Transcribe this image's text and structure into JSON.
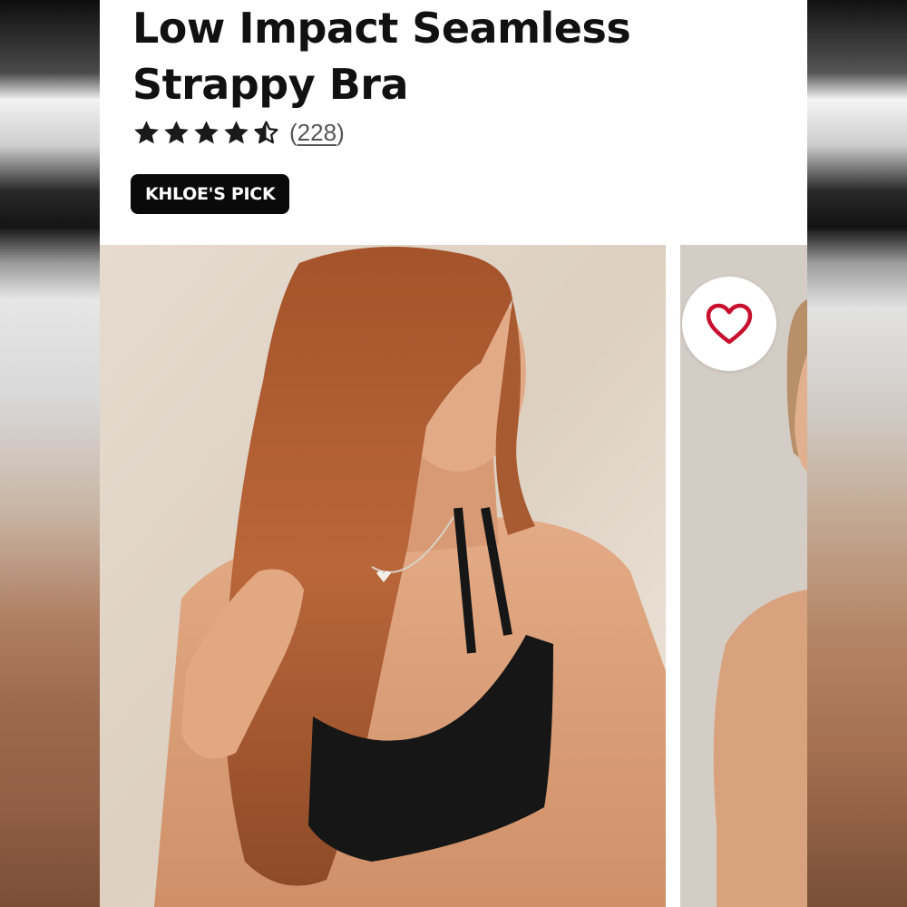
{
  "product": {
    "title": "Low Impact Seamless Strappy Bra",
    "rating": 4.5,
    "review_count": "228",
    "badge": "KHLOE'S PICK"
  },
  "gallery": {
    "wishlist_icon": "heart-outline-icon",
    "colors": {
      "heart": "#c8102e",
      "star": "#1a1a1a"
    }
  }
}
